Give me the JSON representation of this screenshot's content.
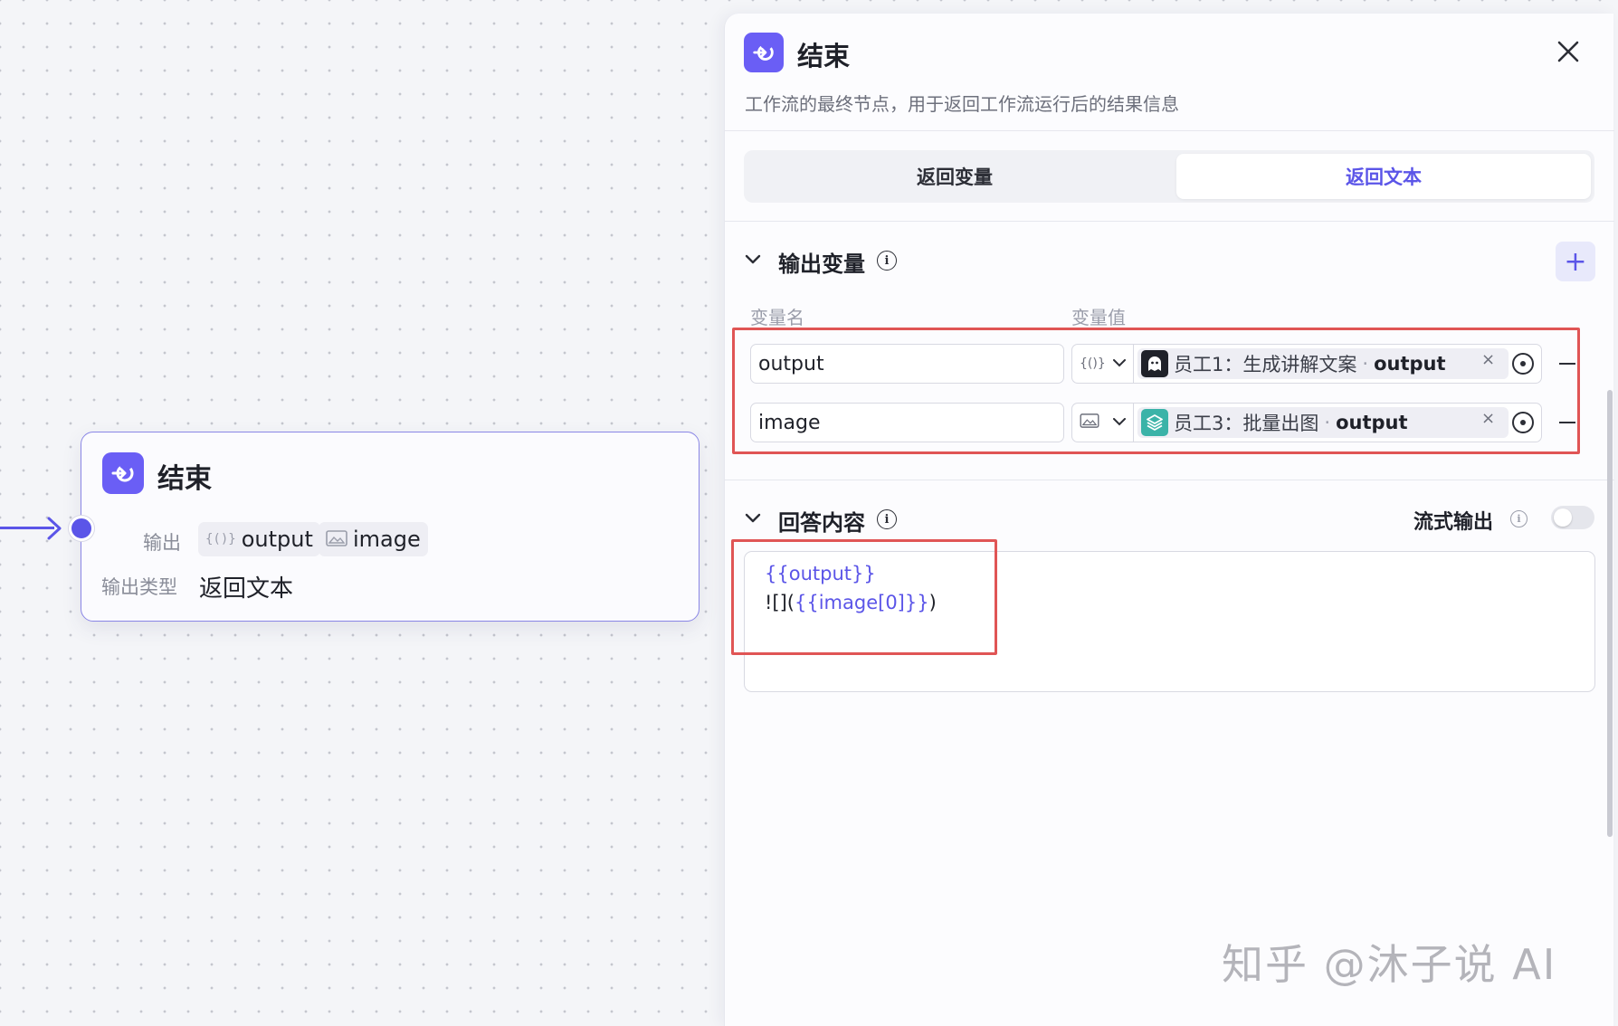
{
  "node": {
    "title": "结束",
    "output_label": "输出",
    "output_chips": [
      {
        "icon": "{()}",
        "label": "output"
      },
      {
        "icon": "image-icon",
        "label": "image"
      }
    ],
    "type_label": "输出类型",
    "type_value": "返回文本"
  },
  "panel": {
    "title": "结束",
    "description": "工作流的最终节点，用于返回工作流运行后的结果信息",
    "tabs": [
      {
        "label": "返回变量",
        "active": false
      },
      {
        "label": "返回文本",
        "active": true
      }
    ],
    "output_section": {
      "title": "输出变量",
      "col_name": "变量名",
      "col_value": "变量值",
      "rows": [
        {
          "name": "output",
          "type_icon": "{()}",
          "source": "员工1：生成讲解文案",
          "field": "output",
          "source_icon": "ghost-icon"
        },
        {
          "name": "image",
          "type_icon": "image-icon",
          "source": "员工3：批量出图",
          "field": "output",
          "source_icon": "layers-icon"
        }
      ]
    },
    "answer_section": {
      "title": "回答内容",
      "stream_label": "流式输出",
      "stream_on": false,
      "line1": "{{output}}",
      "line2_prefix": "![](",
      "line2_var": "{{image[0]}}",
      "line2_suffix": ")"
    }
  },
  "watermark": "知乎 @沐子说 AI",
  "colors": {
    "accent": "#5b55e8",
    "node_icon": "#6a5ef5",
    "highlight": "#e05555"
  }
}
